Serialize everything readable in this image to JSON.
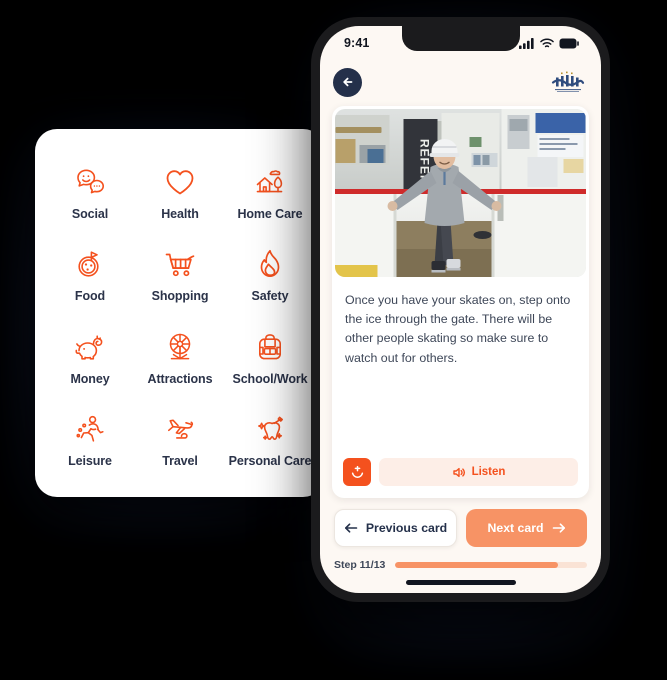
{
  "accent": {
    "orange": "#f4511e",
    "coral": "#f79365",
    "navy": "#24304a",
    "text": "#3e4758",
    "cream": "#fdf8f3",
    "listen_bg": "#fdeee7",
    "track_bg": "#fae3d5"
  },
  "category_panel": {
    "name": "category-grid",
    "items": [
      {
        "label": "Social",
        "icon": "speech-bubbles-icon"
      },
      {
        "label": "Health",
        "icon": "heart-icon"
      },
      {
        "label": "Home Care",
        "icon": "house-tree-icon"
      },
      {
        "label": "Food",
        "icon": "pizza-icon"
      },
      {
        "label": "Shopping",
        "icon": "shopping-cart-icon"
      },
      {
        "label": "Safety",
        "icon": "flame-icon"
      },
      {
        "label": "Money",
        "icon": "piggy-bank-icon"
      },
      {
        "label": "Attractions",
        "icon": "ferris-wheel-icon"
      },
      {
        "label": "School/Work",
        "icon": "backpack-icon"
      },
      {
        "label": "Leisure",
        "icon": "running-person-icon"
      },
      {
        "label": "Travel",
        "icon": "airplane-icon"
      },
      {
        "label": "Personal Care",
        "icon": "tooth-brush-icon"
      }
    ]
  },
  "phone": {
    "status_bar": {
      "time": "9:41",
      "icons": [
        "cellular-signal-icon",
        "wifi-icon",
        "battery-icon"
      ]
    },
    "header": {
      "back_icon": "back-arrow-icon",
      "logo_alt": "halton-hills-logo"
    },
    "card": {
      "image_alt": "person-in-helmet-at-ice-rink-gate",
      "body_text": "Once you have your skates on, step onto the ice through the gate. There will be other people skating so make sure to watch out for others.",
      "emoji_button_icon": "smiley-face-icon",
      "listen_label": "Listen",
      "listen_icon": "speaker-icon"
    },
    "nav": {
      "previous_label": "Previous card",
      "previous_icon": "arrow-left-icon",
      "next_label": "Next card",
      "next_icon": "arrow-right-icon"
    },
    "progress": {
      "step_label": "Step 11/13",
      "current": 11,
      "total": 13,
      "percent": 85
    }
  }
}
